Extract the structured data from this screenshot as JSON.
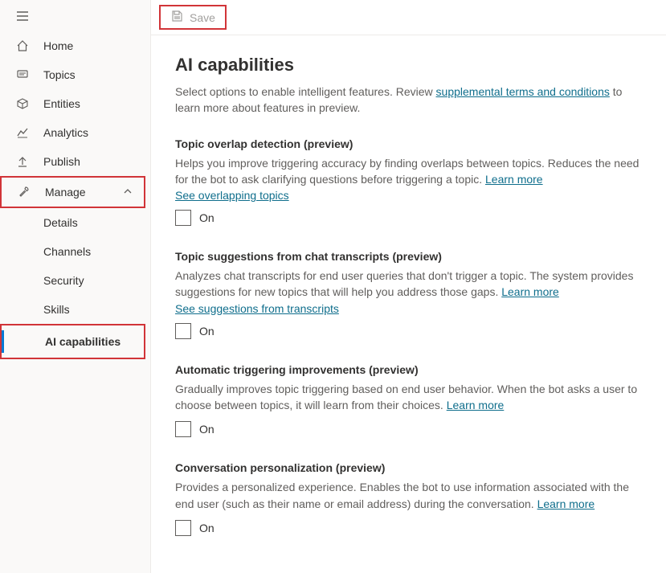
{
  "sidebar": {
    "items": [
      {
        "label": "Home"
      },
      {
        "label": "Topics"
      },
      {
        "label": "Entities"
      },
      {
        "label": "Analytics"
      },
      {
        "label": "Publish"
      },
      {
        "label": "Manage"
      }
    ],
    "manage_children": [
      {
        "label": "Details"
      },
      {
        "label": "Channels"
      },
      {
        "label": "Security"
      },
      {
        "label": "Skills"
      },
      {
        "label": "AI capabilities"
      }
    ]
  },
  "toolbar": {
    "save_label": "Save"
  },
  "page": {
    "title": "AI capabilities",
    "intro_prefix": "Select options to enable intelligent features. Review ",
    "intro_link": "supplemental terms and conditions",
    "intro_suffix": " to learn more about features in preview."
  },
  "sections": [
    {
      "title": "Topic overlap detection (preview)",
      "desc": "Helps you improve triggering accuracy by finding overlaps between topics. Reduces the need for the bot to ask clarifying questions before triggering a topic. ",
      "learn_more": "Learn more",
      "action_link": "See overlapping topics",
      "toggle": "On"
    },
    {
      "title": "Topic suggestions from chat transcripts (preview)",
      "desc": "Analyzes chat transcripts for end user queries that don't trigger a topic. The system provides suggestions for new topics that will help you address those gaps. ",
      "learn_more": "Learn more",
      "action_link": "See suggestions from transcripts",
      "toggle": "On"
    },
    {
      "title": "Automatic triggering improvements (preview)",
      "desc": "Gradually improves topic triggering based on end user behavior. When the bot asks a user to choose between topics, it will learn from their choices. ",
      "learn_more": "Learn more",
      "action_link": "",
      "toggle": "On"
    },
    {
      "title": "Conversation personalization (preview)",
      "desc": "Provides a personalized experience. Enables the bot to use information associated with the end user (such as their name or email address) during the conversation. ",
      "learn_more": "Learn more",
      "action_link": "",
      "toggle": "On"
    }
  ]
}
